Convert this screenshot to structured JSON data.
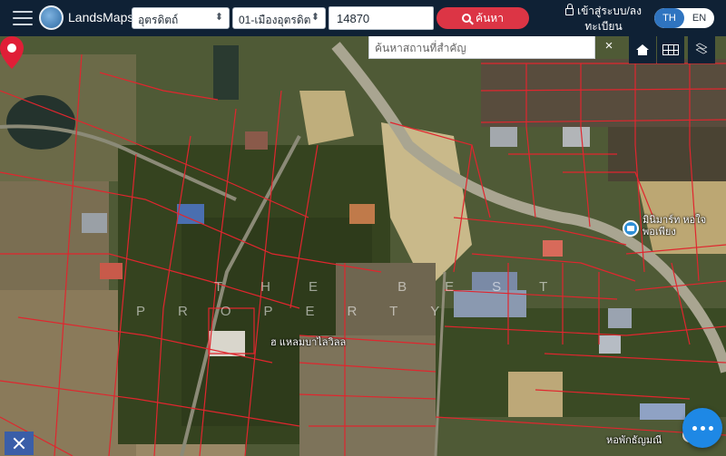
{
  "header": {
    "brand": "LandsMaps",
    "province": "อุตรดิตถ์",
    "district": "01-เมืองอุตรดิต",
    "postal_code": "14870",
    "search_label": "ค้นหา",
    "login_label": "เข้าสู่ระบบ/ลงทะเบียน",
    "lang_th": "TH",
    "lang_en": "EN"
  },
  "map": {
    "poi_search_placeholder": "ค้นหาสถานที่สำคัญ",
    "poi_clear": "×",
    "watermark_line1": "THE BEST",
    "watermark_line2": "PROPERTY",
    "pin_label": "ฮ แหลมบาไลวิลล",
    "poi_shop": "มินิมาร์ท หอใจ พอเพียง",
    "poi_dorm": "หอพักธัญมณี",
    "icons": {
      "menu": "hamburger-icon",
      "home": "home-icon",
      "grid": "parcel-grid-icon",
      "layers": "layers-icon",
      "more": "more-dots-icon",
      "measure": "measure-tool-icon"
    },
    "colors": {
      "header_bg": "#0f2135",
      "search_button": "#dc3545",
      "parcel_lines": "#e0262e",
      "pin": "#e01e37",
      "fab": "#1e88e5"
    }
  }
}
